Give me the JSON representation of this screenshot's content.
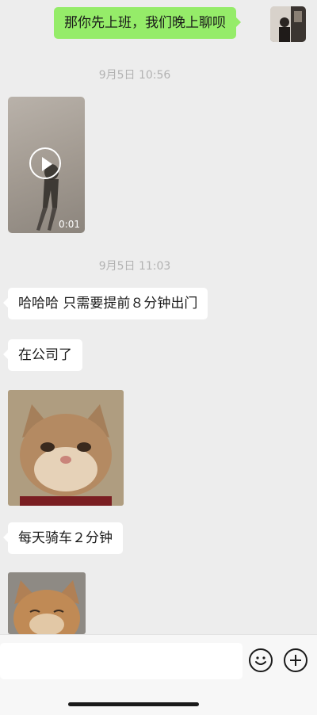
{
  "messages": {
    "m1": "那你先上班，我们晚上聊呗",
    "t1": "9月5日 10:56",
    "video_duration": "0:01",
    "t2": "9月5日 11:03",
    "m2": "哈哈哈 只需要提前８分钟出门",
    "m3": "在公司了",
    "m4": "每天骑车２分钟"
  },
  "icons": {
    "emoji": "smile-icon",
    "more": "plus-icon"
  },
  "colors": {
    "background": "#ededed",
    "sent_bubble": "#95ec69",
    "received_bubble": "#ffffff",
    "timestamp": "#b2b2b2"
  }
}
